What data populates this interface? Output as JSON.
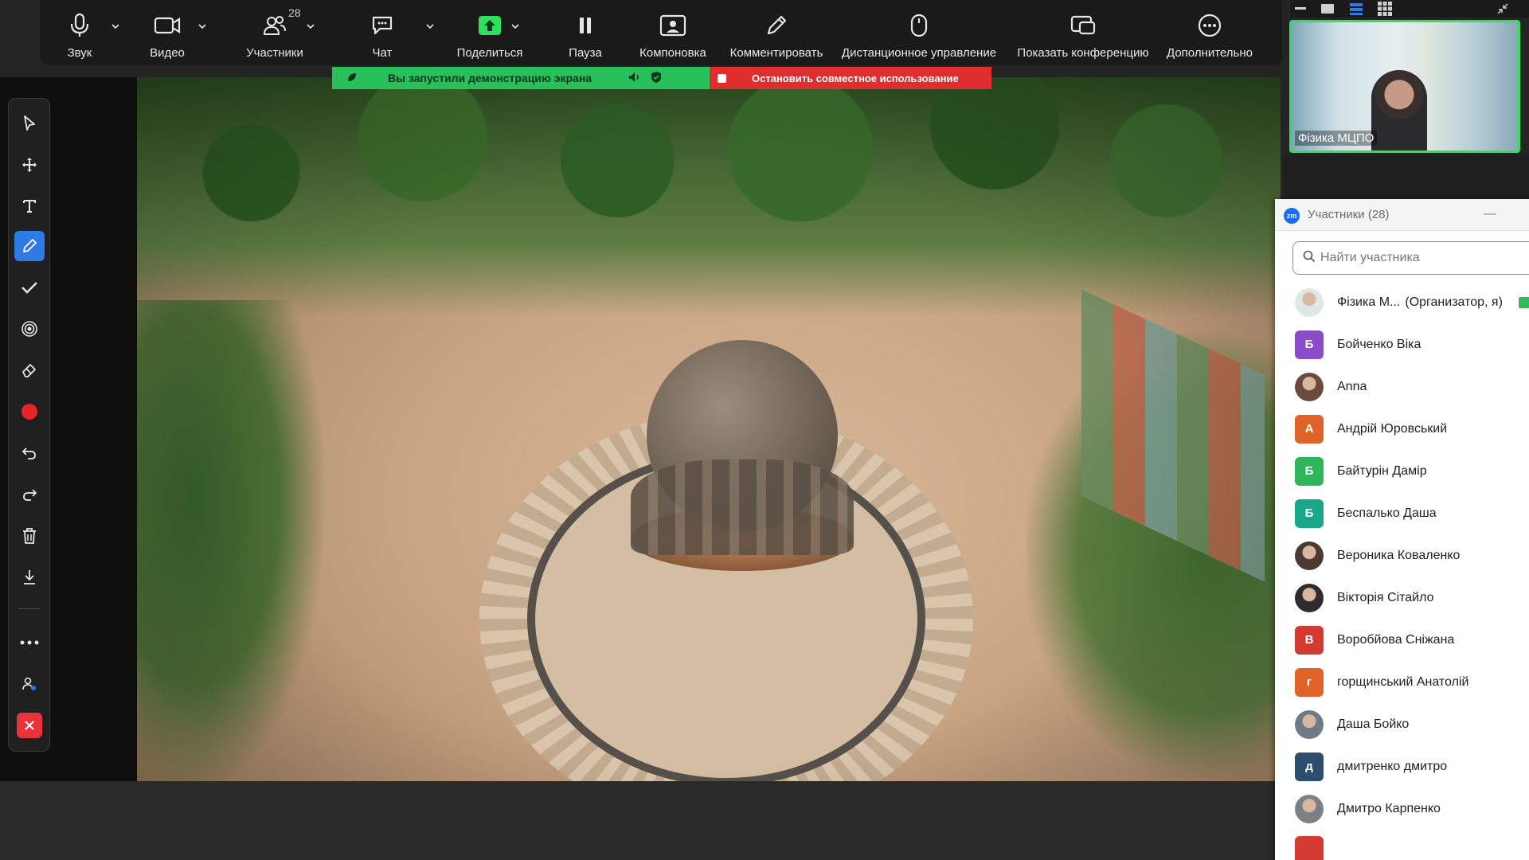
{
  "toolbar": {
    "audio": "Звук",
    "video": "Видео",
    "participants": "Участники",
    "participants_count": "28",
    "chat": "Чат",
    "share": "Поделиться",
    "pause": "Пауза",
    "layout": "Компоновка",
    "annotate": "Комментировать",
    "remote": "Дистанционное управление",
    "show_conf": "Показать конференцию",
    "more": "Дополнительно"
  },
  "share_banner": {
    "status": "Вы запустили демонстрацию экрана",
    "stop": "Остановить совместное использование",
    "green": "#27c05a",
    "red": "#e02d2d"
  },
  "self_video": {
    "name": "Фізика МЦПО"
  },
  "panel": {
    "logo": "zm",
    "title": "Участники (28)",
    "minimize": "—",
    "search_placeholder": "Найти участника",
    "participants": [
      {
        "name": "Фізика М...",
        "note": "(Организатор, я)",
        "avatar_type": "image",
        "avatar_color": "#dfe8e2",
        "initial": ""
      },
      {
        "name": "Бойченко Віка",
        "avatar_type": "letter",
        "avatar_color": "#8b4cc9",
        "initial": "Б"
      },
      {
        "name": "Anna",
        "avatar_type": "image",
        "avatar_color": "#6b4a3e",
        "initial": ""
      },
      {
        "name": "Андрій Юровський",
        "avatar_type": "letter",
        "avatar_color": "#e0642a",
        "initial": "А"
      },
      {
        "name": "Байтурін Дамір",
        "avatar_type": "letter",
        "avatar_color": "#2fb55c",
        "initial": "Б"
      },
      {
        "name": "Беспалько Даша",
        "avatar_type": "letter",
        "avatar_color": "#18a889",
        "initial": "Б"
      },
      {
        "name": "Вероника Коваленко",
        "avatar_type": "image",
        "avatar_color": "#4a3a33",
        "initial": ""
      },
      {
        "name": "Вікторія Сітайло",
        "avatar_type": "image",
        "avatar_color": "#2f2a2d",
        "initial": ""
      },
      {
        "name": "Воробйова Сніжана",
        "avatar_type": "letter",
        "avatar_color": "#d33a32",
        "initial": "В"
      },
      {
        "name": "горщинський Анатолій",
        "avatar_type": "letter",
        "avatar_color": "#e0642a",
        "initial": "г"
      },
      {
        "name": "Даша Бойко",
        "avatar_type": "image",
        "avatar_color": "#6e7a86",
        "initial": ""
      },
      {
        "name": "дмитренко дмитро",
        "avatar_type": "letter",
        "avatar_color": "#2d4d6e",
        "initial": "д"
      },
      {
        "name": "Дмитро Карпенко",
        "avatar_type": "image",
        "avatar_color": "#7b7f86",
        "initial": ""
      }
    ]
  },
  "accent": "#2f7be5",
  "self_border": "#2ee05e"
}
